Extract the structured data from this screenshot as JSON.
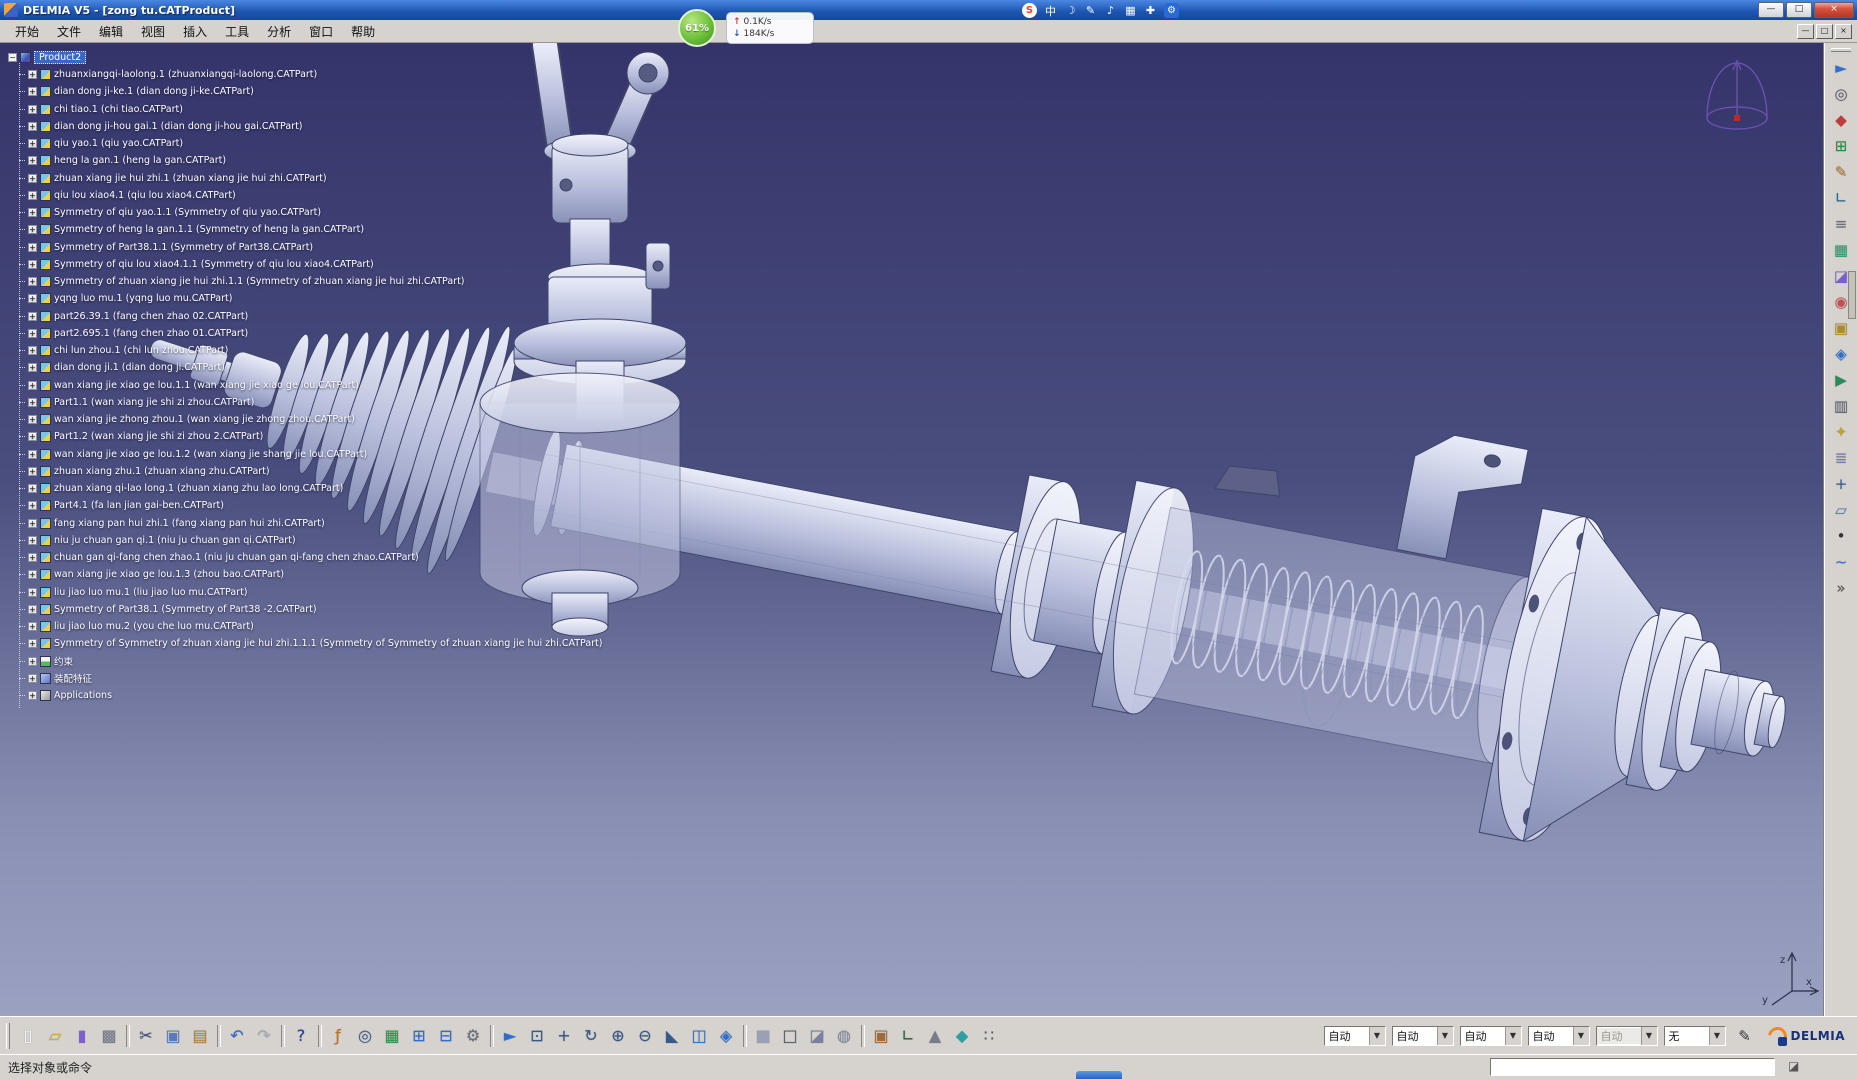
{
  "window": {
    "title": "DELMIA V5 - [zong tu.CATProduct]",
    "controls": {
      "minimize": "—",
      "restore": "□",
      "close": "×"
    }
  },
  "overlay": {
    "cpu_ball": "61%",
    "up_arrow": "↑",
    "down_arrow": "↓",
    "net_up": "0.1K/s",
    "net_down": "184K/s",
    "ime_icons": [
      {
        "name": "sogou-logo-icon",
        "glyph": "S",
        "cls": "ime-logo"
      },
      {
        "name": "ime-cn-mode-icon",
        "glyph": "中"
      },
      {
        "name": "ime-skin-icon",
        "glyph": "☽"
      },
      {
        "name": "ime-handwriting-icon",
        "glyph": "✎"
      },
      {
        "name": "ime-voice-icon",
        "glyph": "♪"
      },
      {
        "name": "ime-keyboard-icon",
        "glyph": "▦"
      },
      {
        "name": "ime-toolbox-icon",
        "glyph": "✚"
      },
      {
        "name": "wrench-icon",
        "glyph": "⚙",
        "cls": "wrench-badge"
      }
    ]
  },
  "menu_bar": {
    "items": [
      {
        "label": "开始"
      },
      {
        "label": "文件"
      },
      {
        "label": "编辑"
      },
      {
        "label": "视图"
      },
      {
        "label": "插入"
      },
      {
        "label": "工具"
      },
      {
        "label": "分析"
      },
      {
        "label": "窗口"
      },
      {
        "label": "帮助"
      }
    ],
    "mdi": {
      "minimize": "—",
      "restore": "□",
      "close": "×"
    }
  },
  "tree": {
    "root": {
      "label": "Product2"
    },
    "root_expander_glyph": "−",
    "expander_glyph": "+",
    "items": [
      {
        "type": "part",
        "label": "zhuanxiangqi-laolong.1 (zhuanxiangqi-laolong.CATPart)"
      },
      {
        "type": "part",
        "label": "dian dong ji-ke.1 (dian dong ji-ke.CATPart)"
      },
      {
        "type": "part",
        "label": "chi tiao.1 (chi tiao.CATPart)"
      },
      {
        "type": "part",
        "label": "dian dong ji-hou gai.1 (dian dong ji-hou gai.CATPart)"
      },
      {
        "type": "part",
        "label": "qiu yao.1 (qiu yao.CATPart)"
      },
      {
        "type": "part",
        "label": "heng la gan.1 (heng la gan.CATPart)"
      },
      {
        "type": "part",
        "label": "zhuan xiang jie hui zhi.1 (zhuan xiang jie hui zhi.CATPart)"
      },
      {
        "type": "part",
        "label": "qiu lou xiao4.1 (qiu lou xiao4.CATPart)"
      },
      {
        "type": "part",
        "label": "Symmetry of qiu yao.1.1 (Symmetry of qiu yao.CATPart)"
      },
      {
        "type": "part",
        "label": "Symmetry of heng la gan.1.1 (Symmetry of heng la gan.CATPart)"
      },
      {
        "type": "part",
        "label": "Symmetry of Part38.1.1 (Symmetry of Part38.CATPart)"
      },
      {
        "type": "part",
        "label": "Symmetry of qiu lou xiao4.1.1 (Symmetry of qiu lou xiao4.CATPart)"
      },
      {
        "type": "part",
        "label": "Symmetry of zhuan xiang jie hui zhi.1.1 (Symmetry of zhuan xiang jie hui zhi.CATPart)"
      },
      {
        "type": "part",
        "label": "yqng luo mu.1 (yqng luo mu.CATPart)"
      },
      {
        "type": "part",
        "label": "part26.39.1 (fang chen zhao 02.CATPart)"
      },
      {
        "type": "part",
        "label": "part2.695.1 (fang chen zhao 01.CATPart)"
      },
      {
        "type": "part",
        "label": "chi lun zhou.1 (chi lun zhou.CATPart)"
      },
      {
        "type": "part",
        "label": "dian dong ji.1 (dian dong ji.CATPart)"
      },
      {
        "type": "part",
        "label": "wan xiang jie xiao ge lou.1.1 (wan xiang jie xiao ge lou.CATPart)"
      },
      {
        "type": "part",
        "label": "Part1.1 (wan xiang jie shi zi zhou.CATPart)"
      },
      {
        "type": "part",
        "label": "wan xiang jie zhong zhou.1 (wan xiang jie zhong zhou.CATPart)"
      },
      {
        "type": "part",
        "label": "Part1.2 (wan xiang jie shi zi zhou 2.CATPart)"
      },
      {
        "type": "part",
        "label": "wan xiang jie xiao ge lou.1.2 (wan xiang jie shang jie lou.CATPart)"
      },
      {
        "type": "part",
        "label": "zhuan xiang zhu.1 (zhuan xiang zhu.CATPart)"
      },
      {
        "type": "part",
        "label": "zhuan xiang qi-lao long.1 (zhuan xiang zhu lao long.CATPart)"
      },
      {
        "type": "part",
        "label": "Part4.1 (fa lan jian gai-ben.CATPart)"
      },
      {
        "type": "part",
        "label": "fang xiang pan hui zhi.1 (fang xiang pan hui zhi.CATPart)"
      },
      {
        "type": "part",
        "label": "niu ju chuan gan qi.1 (niu ju chuan gan qi.CATPart)"
      },
      {
        "type": "part",
        "label": "chuan gan qi-fang chen zhao.1 (niu ju chuan gan qi-fang chen zhao.CATPart)"
      },
      {
        "type": "part",
        "label": "wan xiang jie xiao ge lou.1.3 (zhou bao.CATPart)"
      },
      {
        "type": "part",
        "label": "liu jiao luo mu.1 (liu jiao luo mu.CATPart)"
      },
      {
        "type": "part",
        "label": "Symmetry of Part38.1 (Symmetry of Part38 -2.CATPart)"
      },
      {
        "type": "part",
        "label": "liu jiao luo mu.2 (you che luo mu.CATPart)"
      },
      {
        "type": "part",
        "label": "Symmetry of Symmetry of zhuan xiang jie hui zhi.1.1.1 (Symmetry of Symmetry of zhuan xiang jie hui zhi.CATPart)"
      },
      {
        "type": "constraints",
        "label": "约束"
      },
      {
        "type": "feature",
        "label": "装配特征"
      },
      {
        "type": "applications",
        "label": "Applications"
      }
    ]
  },
  "viewport": {
    "bg_top": "#34346a",
    "bg_bottom": "#9ba1c1",
    "metal": "#c3c8e0",
    "outline": "#3f4468",
    "axis_labels": {
      "z": "z",
      "x": "x",
      "y": "y"
    }
  },
  "right_toolbar": {
    "icons": [
      {
        "name": "fly-through-icon",
        "glyph": "►",
        "color": "#2f6fd0"
      },
      {
        "name": "examine-icon",
        "glyph": "◎",
        "color": "#555a66"
      },
      {
        "name": "workbench-icon",
        "glyph": "◆",
        "color": "#c23a3a"
      },
      {
        "name": "assembly-design-icon",
        "glyph": "⊞",
        "color": "#2f8a3a"
      },
      {
        "name": "sketcher-icon",
        "glyph": "✎",
        "color": "#b5762a"
      },
      {
        "name": "constraints-tool-icon",
        "glyph": "∟",
        "color": "#2a6a9a"
      },
      {
        "name": "measure-tool-icon",
        "glyph": "≡",
        "color": "#6a6f7a"
      },
      {
        "name": "material-icon",
        "glyph": "▦",
        "color": "#2f9a6a"
      },
      {
        "name": "section-icon",
        "glyph": "◪",
        "color": "#7a5fd2"
      },
      {
        "name": "clash-icon",
        "glyph": "◉",
        "color": "#c25050"
      },
      {
        "name": "annotation-icon",
        "glyph": "▣",
        "color": "#b08a2a"
      },
      {
        "name": "dmu-review-icon",
        "glyph": "◈",
        "color": "#2f6fd0"
      },
      {
        "name": "simulation-icon",
        "glyph": "▶",
        "color": "#2a8a5a"
      },
      {
        "name": "camera-icon",
        "glyph": "▥",
        "color": "#5a5f6a"
      },
      {
        "name": "light-icon",
        "glyph": "✦",
        "color": "#c2a22a"
      },
      {
        "name": "layers-icon",
        "glyph": "≣",
        "color": "#7a80a0"
      },
      {
        "name": "axis-system-icon",
        "glyph": "+",
        "color": "#2f5f9a"
      },
      {
        "name": "plane-icon",
        "glyph": "▱",
        "color": "#5b79c0"
      },
      {
        "name": "point-icon",
        "glyph": "•",
        "color": "#333333"
      },
      {
        "name": "curve-icon",
        "glyph": "~",
        "color": "#2f6fd0"
      },
      {
        "name": "more-tools-icon",
        "glyph": "»",
        "color": "#555555"
      }
    ]
  },
  "bottom_toolbar": {
    "combo_arrow": "▼",
    "icons": [
      {
        "name": "new-file-icon",
        "glyph": "▯",
        "color": "#fbfbff"
      },
      {
        "name": "open-folder-icon",
        "glyph": "▱",
        "color": "#e0a92c"
      },
      {
        "name": "save-icon",
        "glyph": "▮",
        "color": "#7e5fd2"
      },
      {
        "name": "print-icon",
        "glyph": "▩",
        "color": "#7a7f8a"
      },
      {
        "name": "toolbar-separator",
        "cls": "sep"
      },
      {
        "name": "cut-icon",
        "glyph": "✂",
        "color": "#44507a"
      },
      {
        "name": "copy-icon",
        "glyph": "▣",
        "color": "#5b79c0"
      },
      {
        "name": "paste-icon",
        "glyph": "▤",
        "color": "#b5873f"
      },
      {
        "name": "toolbar-separator",
        "cls": "sep"
      },
      {
        "name": "undo-icon",
        "glyph": "↶",
        "color": "#2f6fd0"
      },
      {
        "name": "redo-icon",
        "glyph": "↷",
        "color": "#a9adba"
      },
      {
        "name": "toolbar-separator",
        "cls": "sep"
      },
      {
        "name": "whats-this-icon",
        "glyph": "?",
        "color": "#1f3f8f"
      },
      {
        "name": "toolbar-separator",
        "cls": "sep"
      },
      {
        "name": "formula-icon",
        "glyph": "ƒ",
        "color": "#c5731e"
      },
      {
        "name": "search-icon",
        "glyph": "◎",
        "color": "#3a5f8a"
      },
      {
        "name": "design-table-icon",
        "glyph": "▦",
        "color": "#2f9a4a"
      },
      {
        "name": "product-structure-icon",
        "glyph": "⊞",
        "color": "#2f6fd0"
      },
      {
        "name": "graph-tree-icon",
        "glyph": "⊟",
        "color": "#2f6fd0"
      },
      {
        "name": "options-gear-icon",
        "glyph": "⚙",
        "color": "#6a6f7a"
      },
      {
        "name": "toolbar-separator",
        "cls": "sep"
      },
      {
        "name": "fly-mode-icon",
        "glyph": "►",
        "color": "#2f6fd0"
      },
      {
        "name": "fit-all-icon",
        "glyph": "⊡",
        "color": "#355a8a"
      },
      {
        "name": "pan-icon",
        "glyph": "+",
        "color": "#355a8a"
      },
      {
        "name": "rotate-icon",
        "glyph": "↻",
        "color": "#355a8a"
      },
      {
        "name": "zoom-in-icon",
        "glyph": "⊕",
        "color": "#355a8a"
      },
      {
        "name": "zoom-out-icon",
        "glyph": "⊖",
        "color": "#355a8a"
      },
      {
        "name": "normal-view-icon",
        "glyph": "◣",
        "color": "#355a8a"
      },
      {
        "name": "multi-view-icon",
        "glyph": "◫",
        "color": "#2f6fd0"
      },
      {
        "name": "iso-view-icon",
        "glyph": "◈",
        "color": "#2f6fd0"
      },
      {
        "name": "toolbar-separator",
        "cls": "sep"
      },
      {
        "name": "shaded-view-icon",
        "glyph": "■",
        "color": "#9aa0b5"
      },
      {
        "name": "wireframe-view-icon",
        "glyph": "□",
        "color": "#555a66"
      },
      {
        "name": "render-style-icon",
        "glyph": "◪",
        "color": "#7a80a0"
      },
      {
        "name": "hide-show-icon",
        "glyph": "◍",
        "color": "#888fa5"
      },
      {
        "name": "toolbar-separator",
        "cls": "sep"
      },
      {
        "name": "catalog-icon",
        "glyph": "▣",
        "color": "#a06a3a"
      },
      {
        "name": "measure-between-icon",
        "glyph": "∟",
        "color": "#2a6a3a"
      },
      {
        "name": "mass-properties-icon",
        "glyph": "▲",
        "color": "#777d8a"
      },
      {
        "name": "apply-material-icon",
        "glyph": "◆",
        "color": "#2aa0a0"
      },
      {
        "name": "snap-grid-icon",
        "glyph": "∷",
        "color": "#5a5f6a"
      }
    ],
    "combos": [
      {
        "value": "自动"
      },
      {
        "value": "自动"
      },
      {
        "value": "自动"
      },
      {
        "value": "自动"
      },
      {
        "value": "自动",
        "cls": "disabled"
      },
      {
        "value": "无"
      }
    ],
    "pencil_glyph": "✎"
  },
  "logo": {
    "brand": "DELMIA"
  },
  "status_bar": {
    "message": "选择对象或命令"
  }
}
